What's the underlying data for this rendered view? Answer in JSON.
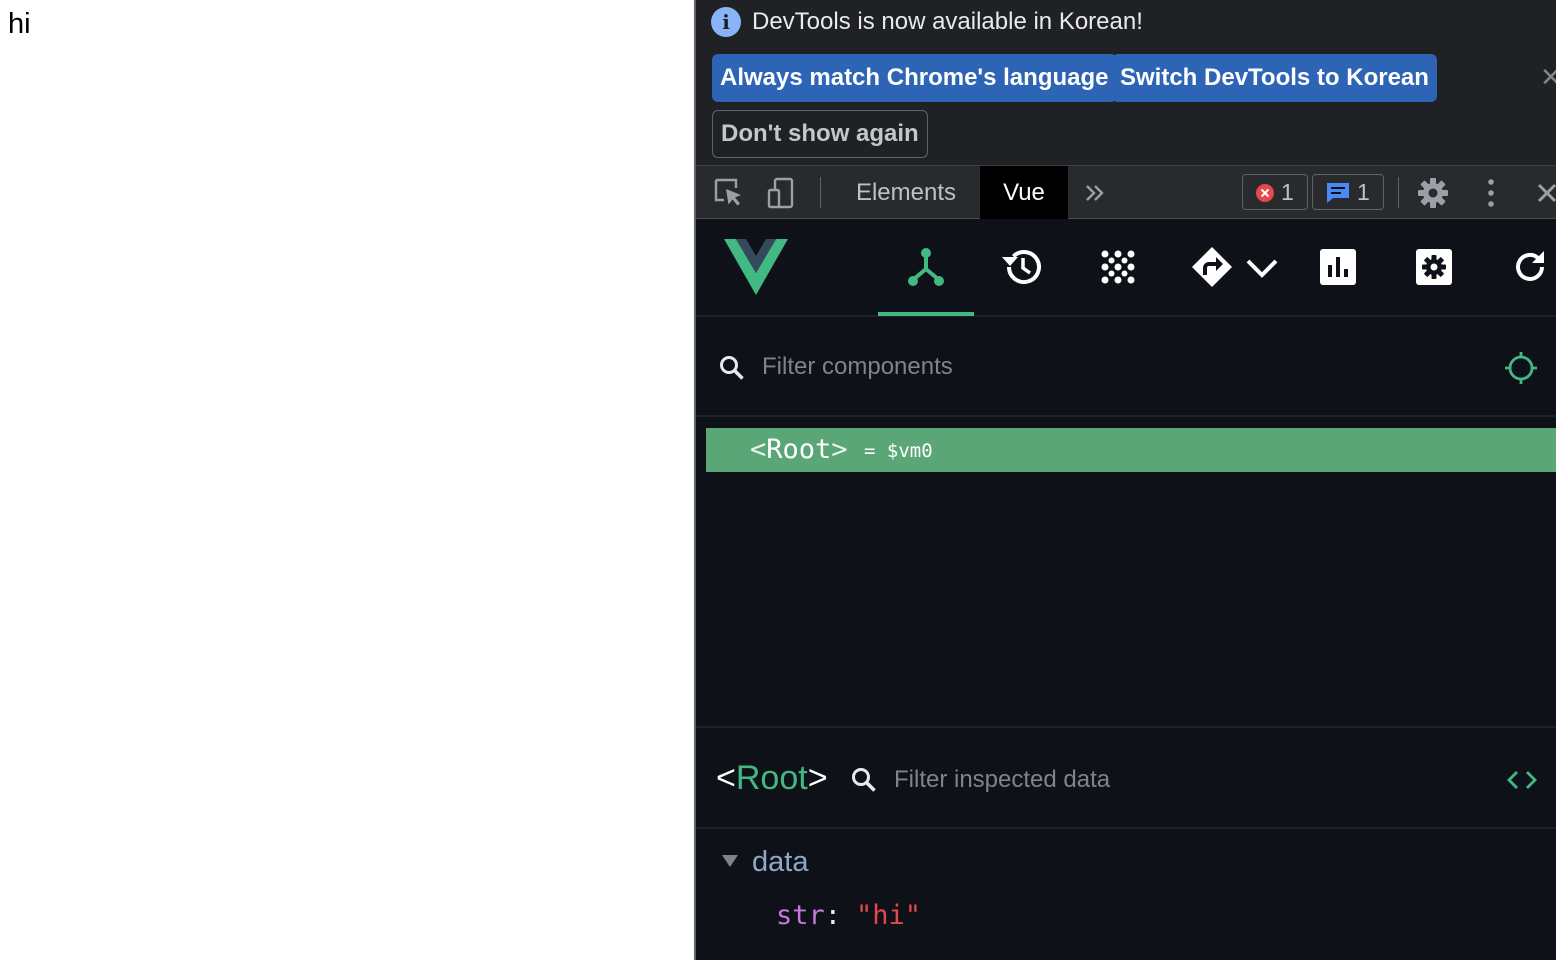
{
  "page": {
    "text": "hi"
  },
  "infobar": {
    "message": "DevTools is now available in Korean!",
    "match_language_label": "Always match Chrome's language",
    "switch_label": "Switch DevTools to Korean",
    "dont_show_label": "Don't show again",
    "close_glyph": "✕"
  },
  "toolbar": {
    "tabs": [
      {
        "label": "Elements",
        "active": false
      },
      {
        "label": "Vue",
        "active": true
      }
    ],
    "errors_count": "1",
    "messages_count": "1"
  },
  "vue_devtools": {
    "nav_icons": [
      "components-icon",
      "timeline-icon",
      "plugins-icon",
      "routes-icon",
      "chevron-down-icon",
      "performance-icon",
      "settings-icon",
      "refresh-icon"
    ],
    "component_filter_placeholder": "Filter components",
    "tree": {
      "open_bracket": "<",
      "component_name": "Root",
      "close_bracket": ">",
      "instance_ref": "= $vm0"
    },
    "inspector": {
      "open_bracket": "<",
      "component_name": "Root",
      "close_bracket": ">",
      "filter_placeholder": "Filter inspected data",
      "section_label": "data",
      "fields": [
        {
          "key": "str",
          "value": "\"hi\""
        }
      ]
    }
  },
  "colors": {
    "vue_green": "#42b883",
    "selected_row": "#5aa676",
    "primary_button": "#2e64b5",
    "info_icon": "#8ab4f8",
    "error_red": "#e5484d"
  }
}
